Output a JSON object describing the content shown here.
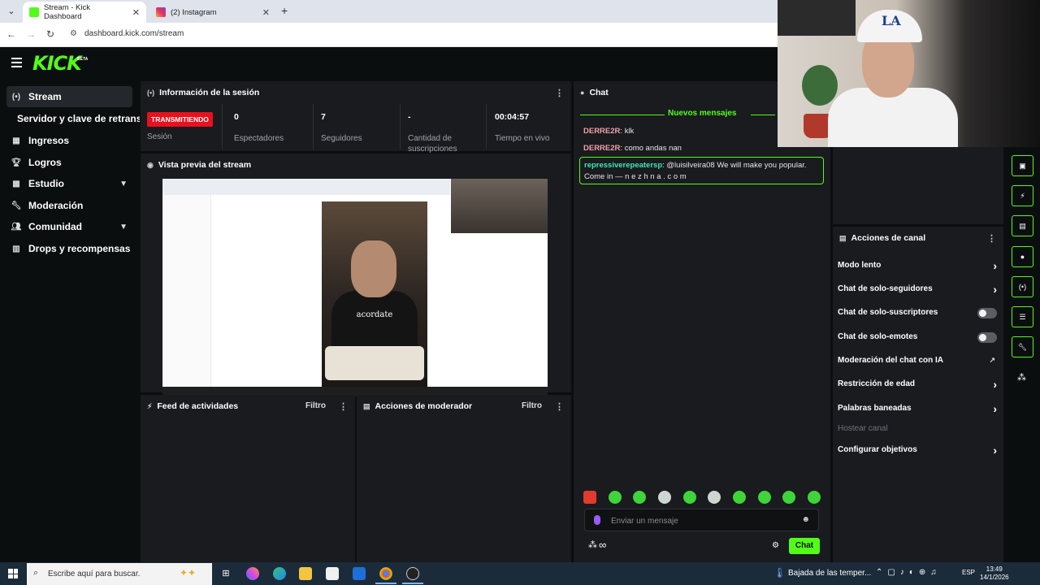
{
  "browser": {
    "tabs": [
      {
        "title": "Stream - Kick Dashboard",
        "active": true
      },
      {
        "title": "(2) Instagram",
        "active": false
      }
    ],
    "new_tab": "+",
    "url": "dashboard.kick.com/stream"
  },
  "header": {
    "logo": "KICK",
    "logo_badge": "BETA"
  },
  "sidebar": {
    "items": [
      {
        "label": "Stream",
        "icon": "broadcast-icon",
        "active": true
      },
      {
        "label": "Servidor y clave de retransmisión",
        "icon": "",
        "sub": true
      },
      {
        "label": "Ingresos",
        "icon": "dollar-icon"
      },
      {
        "label": "Logros",
        "icon": "trophy-icon"
      },
      {
        "label": "Estudio",
        "icon": "studio-icon",
        "expandable": true
      },
      {
        "label": "Moderación",
        "icon": "wrench-icon"
      },
      {
        "label": "Comunidad",
        "icon": "users-icon",
        "expandable": true
      },
      {
        "label": "Drops y recompensas",
        "icon": "gift-icon"
      }
    ]
  },
  "session": {
    "title": "Información de la sesión",
    "live_badge": "TRANSMITIENDO",
    "live_label": "Sesión",
    "stats": [
      {
        "value": "0",
        "label": "Espectadores"
      },
      {
        "value": "7",
        "label": "Seguidores"
      },
      {
        "value": "-",
        "label": "Cantidad de suscripciones"
      },
      {
        "value": "00:04:57",
        "label": "Tiempo en vivo"
      }
    ]
  },
  "preview": {
    "title": "Vista previa del stream",
    "caption": "acordate"
  },
  "activity_feed": {
    "title": "Feed de actividades",
    "filter": "Filtro"
  },
  "mod_actions": {
    "title": "Acciones de moderador",
    "filter": "Filtro"
  },
  "chat": {
    "title": "Chat",
    "new_messages": "Nuevos mensajes",
    "messages": [
      {
        "user": "DERRE2R",
        "text": "klk"
      },
      {
        "user": "DERRE2R",
        "text": "como andas nan"
      }
    ],
    "highlight": {
      "user": "repressiverepeatersp",
      "text": "@luisilveira08 We will make you popular. Come in — n e z h n a . c o m"
    },
    "input_placeholder": "Enviar un mensaje",
    "send_label": "Chat",
    "footer_symbol": "∞"
  },
  "channel_actions": {
    "title": "Acciones de canal",
    "items": [
      {
        "label": "Modo lento",
        "control": "chevron"
      },
      {
        "label": "Chat de solo-seguidores",
        "control": "chevron"
      },
      {
        "label": "Chat de solo-suscriptores",
        "control": "toggle",
        "on": false
      },
      {
        "label": "Chat de solo-emotes",
        "control": "toggle",
        "on": false
      },
      {
        "label": "Moderación del chat con IA",
        "control": "external"
      },
      {
        "label": "Restricción de edad",
        "control": "chevron"
      },
      {
        "label": "Palabras baneadas",
        "control": "chevron"
      },
      {
        "label": "Hostear canal",
        "control": "none",
        "disabled": true
      },
      {
        "label": "Configurar objetivos",
        "control": "chevron"
      }
    ]
  },
  "taskbar": {
    "search_placeholder": "Escribe aquí para buscar.",
    "weather": "Bajada de las temper...",
    "language": "ESP",
    "time": "13:49",
    "date": "14/1/2026"
  },
  "colors": {
    "accent": "#53fc18",
    "live": "#e8111d",
    "panel": "#191b1f",
    "background": "#0b0e0f"
  }
}
